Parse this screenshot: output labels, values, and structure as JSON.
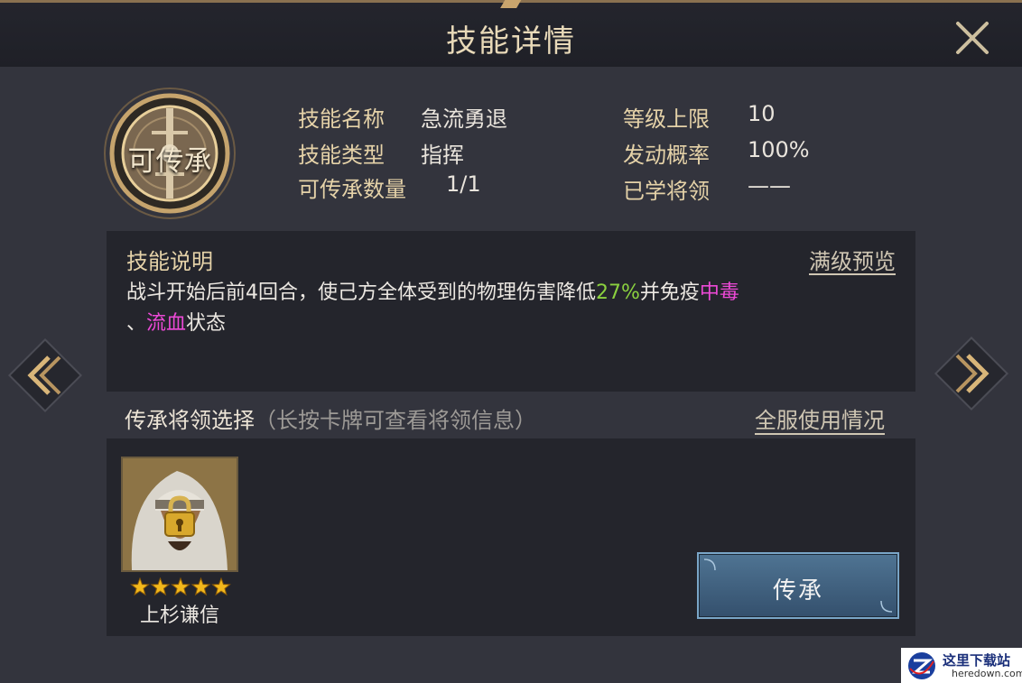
{
  "header": {
    "title": "技能详情"
  },
  "badge": {
    "label": "可传承"
  },
  "skill_info": {
    "name_label": "技能名称",
    "name_value": "急流勇退",
    "type_label": "技能类型",
    "type_value": "指挥",
    "count_label": "可传承数量",
    "count_value": "1/1",
    "max_level_label": "等级上限",
    "max_level_value": "10",
    "rate_label": "发动概率",
    "rate_value": "100%",
    "learned_label": "已学将领",
    "learned_value": "——"
  },
  "description": {
    "title": "技能说明",
    "preview_link": "满级预览",
    "text_part1": "战斗开始后前4回合，使己方全体受到的物理伤害降低",
    "highlight_value": "27%",
    "text_part2": "并免疫",
    "status1": "中毒",
    "separator": "、",
    "status2": "流血",
    "text_part3": "状态"
  },
  "inherit_section": {
    "title": "传承将领选择",
    "hint": "（长按卡牌可查看将领信息）",
    "server_link": "全服使用情况",
    "general": {
      "name": "上杉谦信",
      "stars": 5,
      "locked": true
    },
    "inherit_button": "传承"
  },
  "watermark": {
    "title": "这里下载站",
    "url": "heredown.com"
  },
  "colors": {
    "highlight_green": "#8bd13f",
    "highlight_pink": "#ec49d6",
    "label_gold": "#e5d2a8",
    "button_blue": "#4f7493"
  },
  "icons": [
    "close-icon",
    "arrow-left-icon",
    "arrow-right-icon",
    "lock-icon",
    "star-icon"
  ]
}
